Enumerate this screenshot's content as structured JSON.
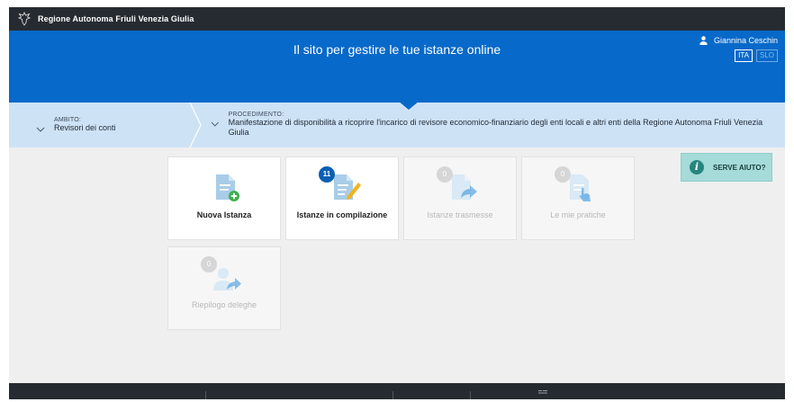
{
  "topbar": {
    "brand": "Regione Autonoma Friuli Venezia Giulia"
  },
  "hero": {
    "title": "Il sito per gestire le tue istanze online",
    "user_name": "Giannina Ceschin",
    "languages": [
      {
        "code": "ITA",
        "active": true
      },
      {
        "code": "SLO",
        "active": false
      }
    ]
  },
  "breadcrumb": {
    "ambito": {
      "label": "AMBITO:",
      "value": "Revisori dei conti"
    },
    "procedimento": {
      "label": "PROCEDIMENTO:",
      "value": "Manifestazione di disponibilità a ricoprire l'incarico di revisore economico-finanziario degli enti locali e altri enti della Regione Autonoma Friuli Venezia Giulia"
    }
  },
  "tiles": [
    {
      "label": "Nuova Istanza",
      "enabled": true,
      "icon": "new-document-icon"
    },
    {
      "label": "Istanze in compilazione",
      "enabled": true,
      "badge": "11",
      "icon": "edit-document-icon"
    },
    {
      "label": "Istanze trasmesse",
      "enabled": false,
      "badge": "0",
      "icon": "send-document-icon"
    },
    {
      "label": "Le mie pratiche",
      "enabled": false,
      "badge": "0",
      "icon": "hand-document-icon"
    },
    {
      "label": "Riepilogo deleghe",
      "enabled": false,
      "badge": "0",
      "icon": "delegate-user-icon"
    }
  ],
  "help": {
    "label": "SERVE AIUTO?"
  },
  "colors": {
    "topbar": "#262b31",
    "hero": "#0769c9",
    "breadcrumb": "#cee2f6",
    "badge_active": "#0b5fb4",
    "help_bg": "#a5dbd8",
    "icon_doc": "#a9cde8",
    "icon_accent_green": "#40b04e",
    "icon_accent_blue": "#2a8fd8",
    "icon_accent_yellow": "#f3b21c"
  }
}
